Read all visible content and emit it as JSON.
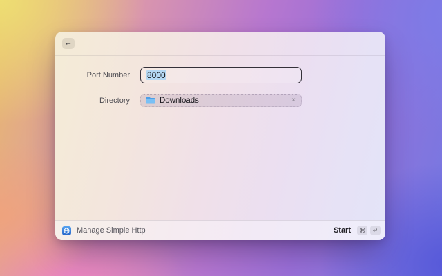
{
  "window": {
    "title": "Manage Simple Http"
  },
  "icons": {
    "back": "←",
    "remove": "×",
    "command_key": "⌘",
    "return_key": "↵",
    "folder": "folder-icon",
    "app": "globe-app-icon"
  },
  "form": {
    "port": {
      "label": "Port Number",
      "value": "8000"
    },
    "directory": {
      "label": "Directory",
      "value": "Downloads"
    }
  },
  "footer": {
    "app_name": "Manage Simple Http",
    "start_label": "Start",
    "shortcut_keys": [
      "⌘",
      "↵"
    ]
  },
  "colors": {
    "selection_highlight": "#b5d8f3",
    "folder_blue": "#4d9fe8",
    "app_icon_blue": "#2f7bdc",
    "input_border": "#343039",
    "bg_yellow": "#eee073",
    "bg_pink": "#ee82c4",
    "bg_blue": "#5456d8",
    "bg_purple": "#9a6fd8"
  }
}
